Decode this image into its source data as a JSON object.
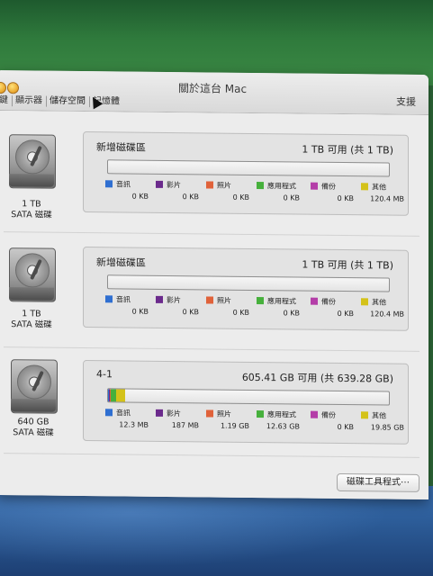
{
  "window": {
    "title": "關於這台 Mac",
    "help_label": "支援"
  },
  "tabs": [
    {
      "label": "鍵"
    },
    {
      "label": "顯示器"
    },
    {
      "label": "儲存空間"
    },
    {
      "label": "記憶體"
    }
  ],
  "legend_colors": {
    "audio": "#2f6fd1",
    "movies": "#6b2a8c",
    "photos": "#e0623a",
    "apps": "#46b03c",
    "backups": "#b43ea8",
    "other": "#d4c219"
  },
  "disks": [
    {
      "size": "1 TB",
      "type": "SATA 磁碟",
      "volume": "新增磁碟區",
      "capacity": "1 TB 可用 (共 1 TB)",
      "usage_fraction": {
        "audio": 0,
        "movies": 0,
        "photos": 0,
        "apps": 0,
        "backups": 0,
        "other": 0
      },
      "legend": [
        {
          "key": "audio",
          "name": "音訊",
          "value": "0 KB"
        },
        {
          "key": "movies",
          "name": "影片",
          "value": "0 KB"
        },
        {
          "key": "photos",
          "name": "照片",
          "value": "0 KB"
        },
        {
          "key": "apps",
          "name": "應用程式",
          "value": "0 KB"
        },
        {
          "key": "backups",
          "name": "備份",
          "value": "0 KB"
        },
        {
          "key": "other",
          "name": "其他",
          "value": "120.4 MB"
        }
      ]
    },
    {
      "size": "1 TB",
      "type": "SATA 磁碟",
      "volume": "新增磁碟區",
      "capacity": "1 TB 可用 (共 1 TB)",
      "usage_fraction": {
        "audio": 0,
        "movies": 0,
        "photos": 0,
        "apps": 0,
        "backups": 0,
        "other": 0
      },
      "legend": [
        {
          "key": "audio",
          "name": "音訊",
          "value": "0 KB"
        },
        {
          "key": "movies",
          "name": "影片",
          "value": "0 KB"
        },
        {
          "key": "photos",
          "name": "照片",
          "value": "0 KB"
        },
        {
          "key": "apps",
          "name": "應用程式",
          "value": "0 KB"
        },
        {
          "key": "backups",
          "name": "備份",
          "value": "0 KB"
        },
        {
          "key": "other",
          "name": "其他",
          "value": "120.4 MB"
        }
      ]
    },
    {
      "size": "640 GB",
      "type": "SATA 磁碟",
      "volume": "4-1",
      "capacity": "605.41 GB 可用 (共 639.28 GB)",
      "usage_fraction": {
        "audio": 0.0001,
        "movies": 0.0003,
        "photos": 0.0019,
        "apps": 0.0198,
        "backups": 0,
        "other": 0.031
      },
      "legend": [
        {
          "key": "audio",
          "name": "音訊",
          "value": "12.3 MB"
        },
        {
          "key": "movies",
          "name": "影片",
          "value": "187 MB"
        },
        {
          "key": "photos",
          "name": "照片",
          "value": "1.19 GB"
        },
        {
          "key": "apps",
          "name": "應用程式",
          "value": "12.63 GB"
        },
        {
          "key": "backups",
          "name": "備份",
          "value": "0 KB"
        },
        {
          "key": "other",
          "name": "其他",
          "value": "19.85 GB"
        }
      ]
    }
  ],
  "disk_utility_button": "磁碟工具程式⋯"
}
